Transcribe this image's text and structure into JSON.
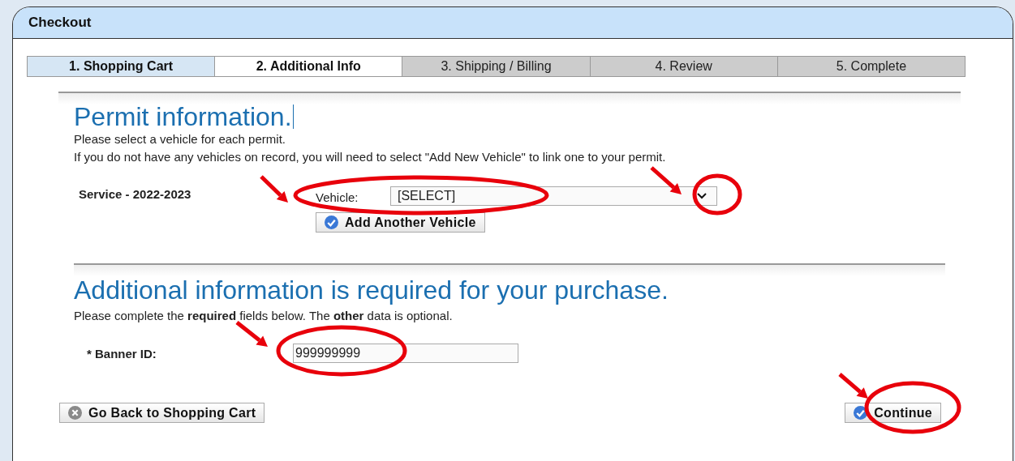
{
  "window": {
    "title": "Checkout"
  },
  "tabs": [
    {
      "label": "1. Shopping Cart",
      "selected": false,
      "completed": true
    },
    {
      "label": "2. Additional Info",
      "selected": true,
      "completed": false
    },
    {
      "label": "3. Shipping / Billing",
      "selected": false,
      "completed": false
    },
    {
      "label": "4. Review",
      "selected": false,
      "completed": false
    },
    {
      "label": "5. Complete",
      "selected": false,
      "completed": false
    }
  ],
  "permit": {
    "heading": "Permit information.",
    "lines": [
      "Please select a vehicle for each permit.",
      "If you do not have any vehicles on record, you will need to select \"Add New Vehicle\" to link one to your permit."
    ],
    "permit_name": "Service - 2022-2023",
    "vehicle_label": "Vehicle:",
    "vehicle_value": "[SELECT]",
    "add_button": "Add Another Vehicle"
  },
  "additional": {
    "heading": "Additional information is required for your purchase.",
    "note": "Please complete the **required** fields below. The **other** data is optional.",
    "fields": [
      {
        "label": "* Banner ID:",
        "value": "999999999"
      }
    ]
  },
  "buttons": [
    {
      "kind": "back",
      "label": "Go Back to Shopping Cart"
    },
    {
      "kind": "continue",
      "label": "Continue"
    }
  ]
}
